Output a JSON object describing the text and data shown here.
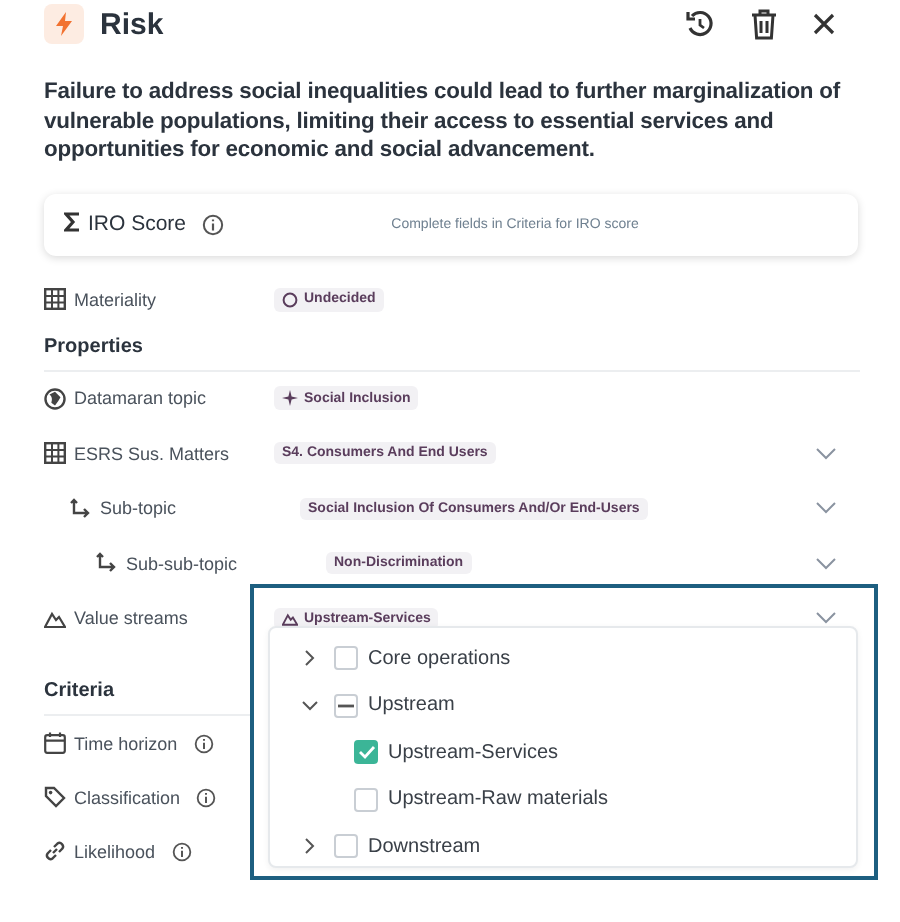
{
  "header": {
    "title": "Risk"
  },
  "description": "Failure to address social inequalities could lead to further marginalization of vulnerable populations, limiting their access to essential services and opportunities for economic and social advancement.",
  "iro_score": {
    "label": "IRO Score",
    "hint": "Complete fields in Criteria for IRO score"
  },
  "materiality": {
    "label": "Materiality",
    "value": "Undecided"
  },
  "properties": {
    "title": "Properties",
    "rows": [
      {
        "label": "Datamaran topic",
        "value": "Social Inclusion",
        "dropdown": false
      },
      {
        "label": "ESRS Sus. Matters",
        "value": "S4. Consumers And End Users",
        "dropdown": true,
        "children": [
          {
            "label": "Sub-topic",
            "value": "Social Inclusion Of Consumers And/Or End-Users",
            "dropdown": true,
            "children": [
              {
                "label": "Sub-sub-topic",
                "value": "Non-Discrimination",
                "dropdown": true
              }
            ]
          }
        ]
      },
      {
        "label": "Value streams",
        "value": "Upstream-Services",
        "dropdown": true,
        "open": true
      }
    ]
  },
  "value_stream_menu": [
    {
      "label": "Core operations",
      "expanded": false,
      "checked": false
    },
    {
      "label": "Upstream",
      "expanded": true,
      "checked": false,
      "indeterminate": true,
      "children": [
        {
          "label": "Upstream-Services",
          "checked": true
        },
        {
          "label": "Upstream-Raw materials",
          "checked": false
        }
      ]
    },
    {
      "label": "Downstream",
      "expanded": false,
      "checked": false
    }
  ],
  "criteria": {
    "title": "Criteria",
    "rows": [
      {
        "label": "Time horizon"
      },
      {
        "label": "Classification"
      },
      {
        "label": "Likelihood"
      }
    ]
  }
}
